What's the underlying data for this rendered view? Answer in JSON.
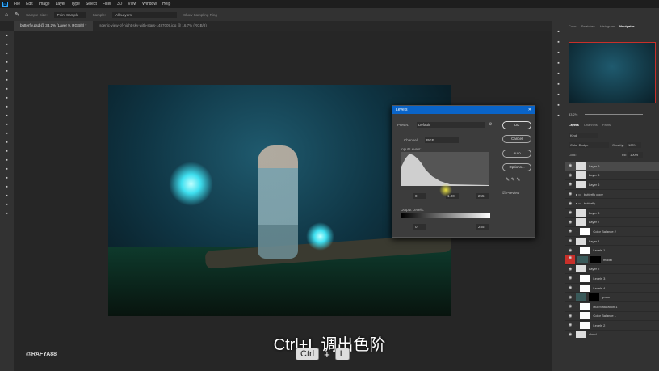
{
  "menu": [
    "File",
    "Edit",
    "Image",
    "Layer",
    "Type",
    "Select",
    "Filter",
    "3D",
    "View",
    "Window",
    "Help"
  ],
  "options": {
    "sample_size_label": "Sample Size:",
    "sample_size": "Point Sample",
    "sample_label": "Sample:",
    "sample": "All Layers",
    "show_ring": "Show Sampling Ring"
  },
  "tabs": [
    "butterfly.psd @ 33.2% (Layer 9, RGB/8) *",
    "scenic-view-of-night-sky-with-stars-1487009.jpg @ 16.7% (RGB/8)"
  ],
  "levels": {
    "title": "Levels",
    "preset_label": "Preset:",
    "preset": "Default",
    "channel_label": "Channel:",
    "channel": "RGB",
    "input_label": "Input Levels:",
    "input": [
      "0",
      "1.00",
      "255"
    ],
    "output_label": "Output Levels:",
    "output": [
      "0",
      "255"
    ],
    "buttons": [
      "OK",
      "Cancel",
      "Auto",
      "Options..."
    ],
    "preview": "Preview"
  },
  "panel_tabs": [
    "Color",
    "Swatches",
    "Histogram",
    "Navigator"
  ],
  "navigator_zoom": "33.2%",
  "layers_tabs": [
    "Layers",
    "Channels",
    "Paths"
  ],
  "layers_filter": "Kind",
  "blend_mode": "Color Dodge",
  "opacity_label": "Opacity:",
  "opacity": "100%",
  "lock_label": "Lock:",
  "fill_label": "Fill:",
  "fill": "100%",
  "layers": [
    {
      "name": "Layer 9",
      "type": "pixel",
      "selected": true
    },
    {
      "name": "Layer 8",
      "type": "pixel"
    },
    {
      "name": "Layer 6",
      "type": "pixel"
    },
    {
      "name": "butterfly copy",
      "type": "group"
    },
    {
      "name": "butterfly",
      "type": "group"
    },
    {
      "name": "Layer 3",
      "type": "pixel"
    },
    {
      "name": "Layer 7",
      "type": "pixel"
    },
    {
      "name": "Color Balance 2",
      "type": "adj"
    },
    {
      "name": "Layer 4",
      "type": "pixel"
    },
    {
      "name": "Levels 1",
      "type": "adj"
    },
    {
      "name": "model",
      "type": "masked",
      "red_eye": true
    },
    {
      "name": "Layer 2",
      "type": "pixel"
    },
    {
      "name": "Levels 3",
      "type": "adj"
    },
    {
      "name": "Levels 4",
      "type": "adj"
    },
    {
      "name": "grass",
      "type": "masked"
    },
    {
      "name": "Hue/Saturation 1",
      "type": "adj"
    },
    {
      "name": "Color Balance 1",
      "type": "adj"
    },
    {
      "name": "Levels 2",
      "type": "adj"
    },
    {
      "name": "cloud",
      "type": "pixel"
    }
  ],
  "caption": "Ctrl+L 调出色阶",
  "keys": [
    "Ctrl",
    "+",
    "L"
  ],
  "watermark": "@RAFYA88"
}
